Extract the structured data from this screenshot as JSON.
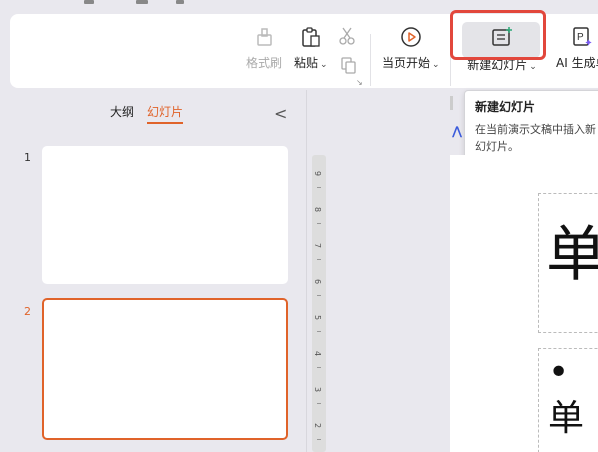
{
  "ribbon": {
    "format_painter": "格式刷",
    "paste": "粘贴",
    "play_current": "当页开始",
    "new_slide": "新建幻灯片",
    "ai_generate": "AI 生成单"
  },
  "tooltip": {
    "title": "新建幻灯片",
    "description": "在当前演示文稿中插入新幻灯片。"
  },
  "panel": {
    "tab_outline": "大纲",
    "tab_slides": "幻灯片",
    "collapse_glyph": "<",
    "slides": [
      {
        "number": "1"
      },
      {
        "number": "2"
      }
    ]
  },
  "ruler": {
    "labels": [
      "9",
      "8",
      "7",
      "6",
      "5",
      "4",
      "3",
      "2"
    ]
  },
  "canvas": {
    "title_char": "单",
    "bullet_text": "• 单"
  },
  "colors": {
    "accent": "#e0632a",
    "highlight": "#e2473c",
    "background": "#e9e8ee"
  }
}
